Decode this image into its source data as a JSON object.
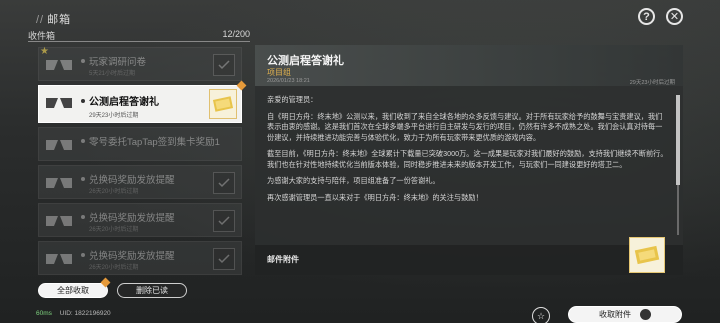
{
  "header": {
    "title": "邮箱",
    "help_icon": "question-icon",
    "close_icon": "close-icon"
  },
  "inbox": {
    "label": "收件箱",
    "count": "12/200"
  },
  "mails": [
    {
      "title": "玩家调研问卷",
      "time": "5天21小时后过期",
      "state": "dim"
    },
    {
      "title": "公测启程答谢礼",
      "time": "29天23小时后过期",
      "state": "selected"
    },
    {
      "title": "零号委托TapTap签到集卡奖励1",
      "time": "",
      "state": "dim"
    },
    {
      "title": "兑换码奖励发放提醒",
      "time": "26天20小时后过期",
      "state": "dim"
    },
    {
      "title": "兑换码奖励发放提醒",
      "time": "26天20小时后过期",
      "state": "dim"
    },
    {
      "title": "兑换码奖励发放提醒",
      "time": "26天20小时后过期",
      "state": "dim"
    }
  ],
  "actions": {
    "collect_all": "全部收取",
    "delete_read": "删除已读",
    "collect_attachment": "收取附件"
  },
  "detail": {
    "title": "公测启程答谢礼",
    "sender": "项目组",
    "date": "2026/01/23 18:21",
    "expire": "29天23小时后过期",
    "greeting": "亲爱的管理员：",
    "paragraphs": [
      "自《明日方舟：终末地》公测以来，我们收到了来自全球各地的众多反馈与建议。对于所有玩家给予的鼓舞与宝贵建议，我们表示由衷的感谢。这是我们首次在全球多端多平台进行自主研发与发行的项目，仍然有许多不成熟之处。我们会认真对待每一份建议，并持续推进功能完善与体验优化，致力于为所有玩家带来更优质的游戏内容。",
      "截至目前，《明日方舟：终末地》全球累计下载量已突破3000万。这一成果是玩家对我们最好的鼓励，支持我们继续不断前行。我们也在针对性地持续优化当前版本体验，同时稳步推进未来的版本开发工作，与玩家们一同建设更好的塔卫二。",
      "为感谢大家的支持与陪伴，项目组准备了一份答谢礼。",
      "再次感谢管理员一直以来对于《明日方舟：终末地》的关注与鼓励！"
    ],
    "attachment_label": "邮件附件"
  },
  "footer": {
    "ping": "60ms",
    "uid": "UID: 1822196920"
  }
}
